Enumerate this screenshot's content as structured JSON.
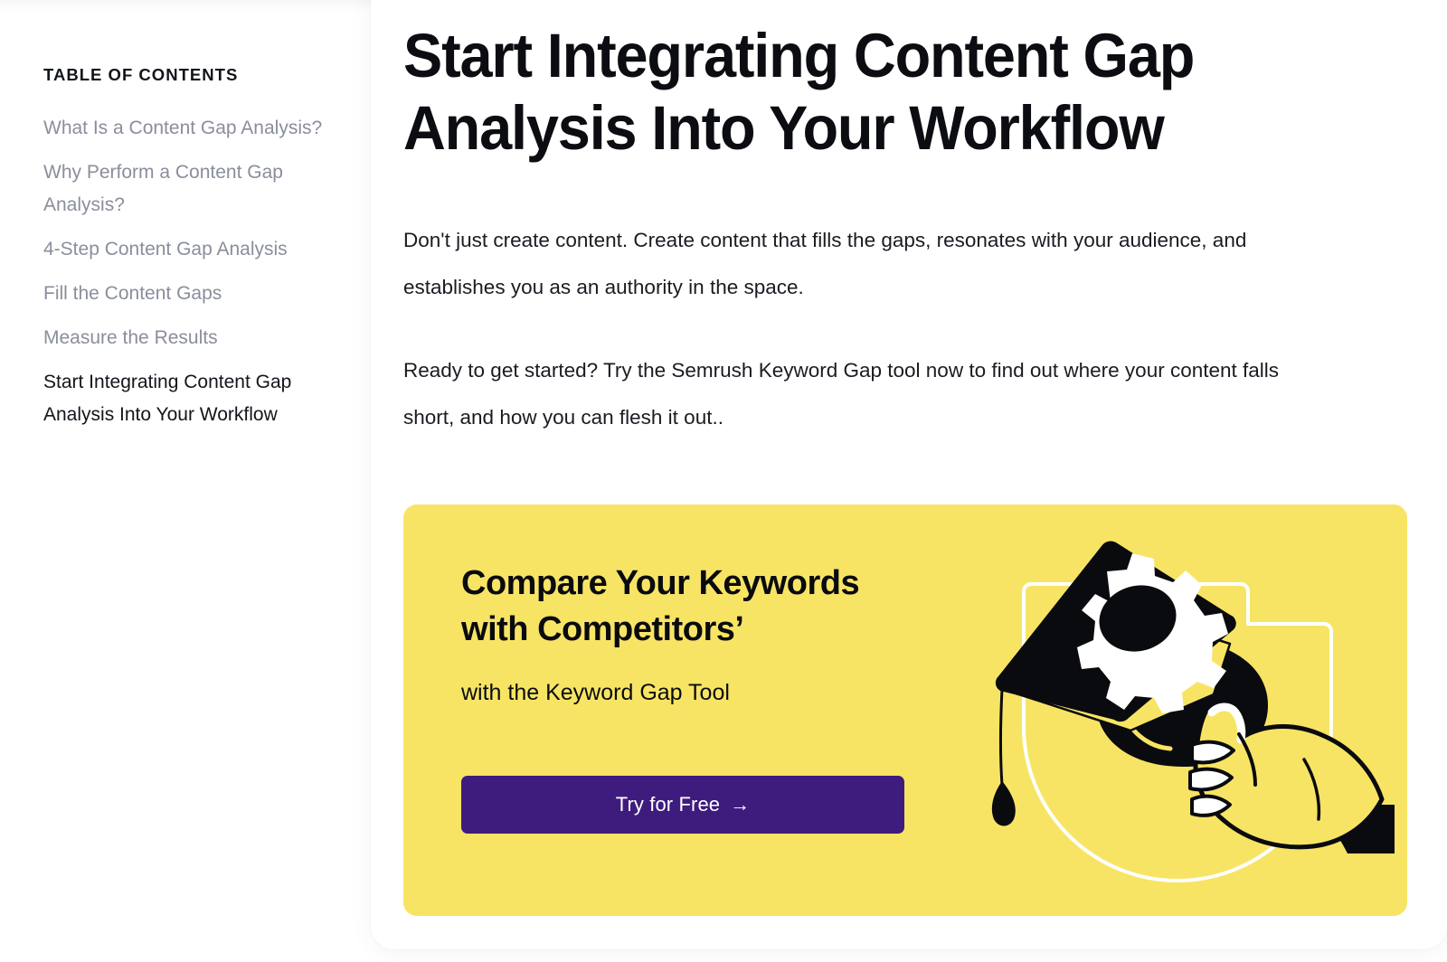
{
  "sidebar": {
    "title": "TABLE OF CONTENTS",
    "items": [
      {
        "label": "What Is a Content Gap Analysis?",
        "active": false
      },
      {
        "label": "Why Perform a Content Gap Analysis?",
        "active": false
      },
      {
        "label": "4-Step Content Gap Analysis",
        "active": false
      },
      {
        "label": "Fill the Content Gaps",
        "active": false
      },
      {
        "label": "Measure the Results",
        "active": false
      },
      {
        "label": "Start Integrating Content Gap Analysis Into Your Workflow",
        "active": true
      }
    ]
  },
  "article": {
    "title": "Start Integrating Content Gap Analysis Into Your Workflow",
    "paragraphs": [
      "Don't just create content. Create content that fills the gaps, resonates with your audience, and establishes you as an authority in the space.",
      "Ready to get started? Try the Semrush Keyword Gap tool now to find out where your content falls short, and how you can flesh it out.."
    ]
  },
  "promo": {
    "heading": "Compare Your Keywords with Competitors’",
    "subheading": "with the Keyword Gap Tool",
    "button_label": "Try for Free",
    "button_arrow": "→",
    "illustration": "hand-holding-graduation-cap-with-gear-icon",
    "colors": {
      "banner_background": "#F8E464",
      "button_background": "#3E1C7D",
      "button_text": "#FFFFFF",
      "heading_text": "#0A0B0F"
    }
  },
  "theme": {
    "page_background": "#FFFFFF",
    "toc_inactive": "#8A8E9C",
    "toc_active": "#12151B",
    "body_text": "#191C22"
  }
}
